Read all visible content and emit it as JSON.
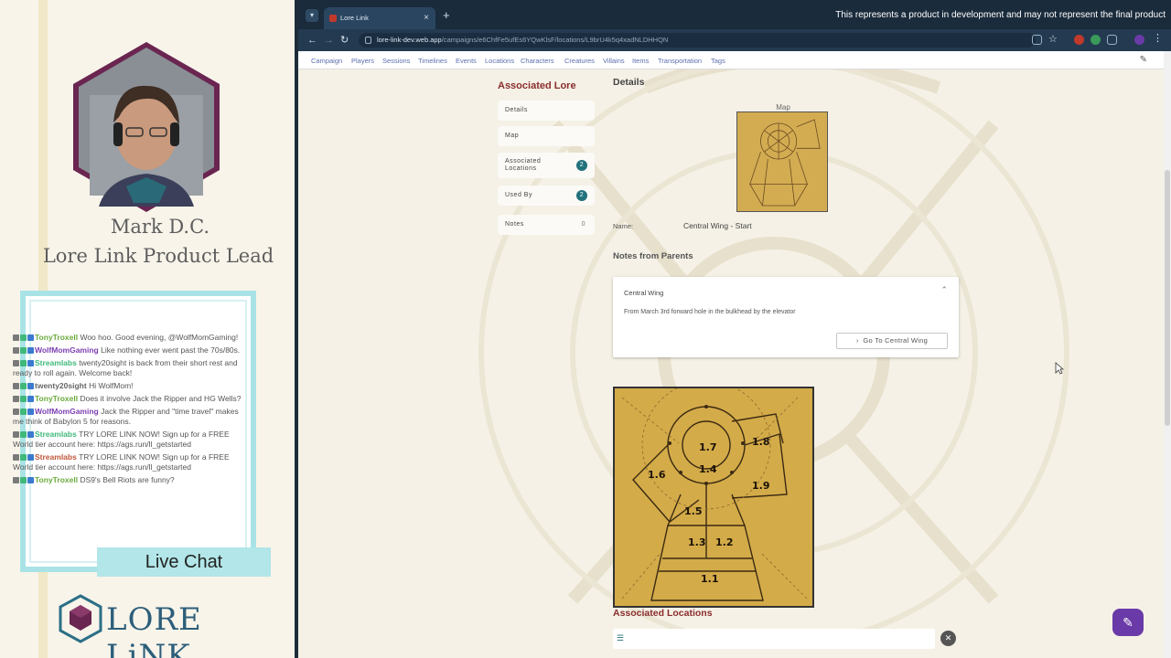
{
  "overlay": {
    "presenter_name": "Mark D.C.",
    "presenter_role": "Lore Link Product Lead",
    "live_chat_label": "Live Chat",
    "logo_text": "LORE LiNK",
    "chat": [
      {
        "user": "TonyTroxell",
        "text": "Woo hoo. Good evening, @WolfMomGaming!",
        "color": "u-olive"
      },
      {
        "user": "WolfMomGaming",
        "text": "Like nothing ever went past the 70s/80s.",
        "color": "u-purple"
      },
      {
        "user": "Streamlabs",
        "text": "twenty20sight is back from their short rest and ready to roll again. Welcome back!",
        "color": "u-green"
      },
      {
        "user": "twenty20sight",
        "text": "Hi WolfMom!",
        "color": "u-gray"
      },
      {
        "user": "TonyTroxell",
        "text": "Does it involve Jack the Ripper and HG Wells?",
        "color": "u-olive"
      },
      {
        "user": "WolfMomGaming",
        "text": "Jack the Ripper and \"time travel\" makes me think of Babylon 5 for reasons.",
        "color": "u-purple"
      },
      {
        "user": "Streamlabs",
        "text": "TRY LORE LINK NOW! Sign up for a FREE World tier account here: https://ags.run/ll_getstarted",
        "color": "u-green"
      },
      {
        "user": "Streamlabs",
        "text": "TRY LORE LINK NOW! Sign up for a FREE World tier account here: https://ags.run/ll_getstarted",
        "color": "u-red"
      },
      {
        "user": "TonyTroxell",
        "text": "DS9's Bell Riots are funny?",
        "color": "u-olive"
      }
    ]
  },
  "browser": {
    "tab_title": "Lore Link",
    "banner": "This represents a product in development and may not represent the final product",
    "url_host": "lore-link-dev.web.app",
    "url_path": "/campaigns/e6ChfFe5ufEs6YQwKlsF/locations/L9brU4k5q4xadNLDHHQN"
  },
  "nav": [
    "Campaign",
    "Players",
    "Sessions",
    "Timelines",
    "Events",
    "Locations",
    "Characters",
    "Creatures",
    "Villains",
    "Items",
    "Transportation",
    "Tags"
  ],
  "sidebar": {
    "title": "Associated Lore",
    "items": [
      {
        "label": "Details",
        "count": ""
      },
      {
        "label": "Map",
        "count": ""
      },
      {
        "label": "Associated Locations",
        "count": "2"
      },
      {
        "label": "Used By",
        "count": "2"
      },
      {
        "label": "Notes",
        "count": "0"
      }
    ]
  },
  "details": {
    "heading": "Details",
    "map_label": "Map",
    "name_label": "Name:",
    "name_value": "Central Wing - Start",
    "notes_heading": "Notes from Parents",
    "parent_name": "Central Wing",
    "parent_note": "From March 3rd forward hole in the bulkhead by the elevator",
    "go_button": "Go To Central Wing",
    "assoc_heading": "Associated Locations"
  },
  "map_rooms": [
    "1.7",
    "1.8",
    "1.4",
    "1.6",
    "1.9",
    "1.5",
    "1.3",
    "1.2",
    "1.1"
  ],
  "colors": {
    "accent": "#8a2d2d",
    "teal": "#22727c",
    "map_fill": "#d4ab49",
    "link": "#5b6fb0",
    "fab": "#6a3aa8"
  }
}
